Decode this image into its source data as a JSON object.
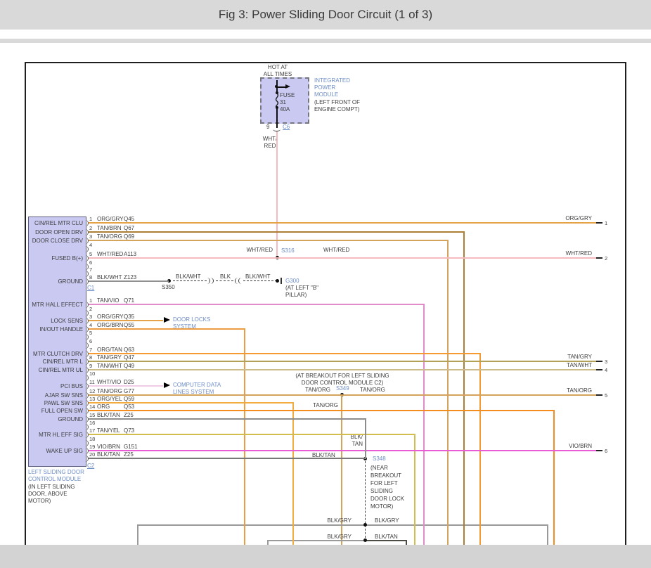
{
  "title": "Fig 3: Power Sliding Door Circuit (1 of 3)",
  "ipm": {
    "hot": "HOT AT\nALL TIMES",
    "fuse": "FUSE\n31\n40A",
    "name": "INTEGRATED\nPOWER\nMODULE",
    "location": "(LEFT FRONT OF\nENGINE COMPT)",
    "pin": "9",
    "connector": "C6",
    "wire": "WHT/\nRED"
  },
  "module": {
    "name": "LEFT SLIDING DOOR\nCONTROL MODULE",
    "location": "(IN LEFT SLIDING\nDOOR, ABOVE\nMOTOR)",
    "c1": "C1",
    "c2": "C2"
  },
  "c1_rows": [
    {
      "pin": "1",
      "label": "CIN/REL MTR CLU",
      "color": "ORG/GRY",
      "circuit": "Q45"
    },
    {
      "pin": "2",
      "label": "DOOR OPEN DRV",
      "color": "TAN/BRN",
      "circuit": "Q67"
    },
    {
      "pin": "3",
      "label": "DOOR CLOSE DRV",
      "color": "TAN/ORG",
      "circuit": "Q69"
    },
    {
      "pin": "4"
    },
    {
      "pin": "5",
      "label": "FUSED B(+)",
      "color": "WHT/RED",
      "circuit": "A113"
    },
    {
      "pin": "6"
    },
    {
      "pin": "7"
    },
    {
      "pin": "8",
      "label": "GROUND",
      "color": "BLK/WHT",
      "circuit": "Z123"
    }
  ],
  "c2_rows": [
    {
      "pin": "1",
      "label": "MTR HALL EFFECT",
      "color": "TAN/VIO",
      "circuit": "Q71"
    },
    {
      "pin": "2"
    },
    {
      "pin": "3",
      "label": "LOCK SENS",
      "color": "ORG/GRY",
      "circuit": "Q35"
    },
    {
      "pin": "4",
      "label": "IN/OUT HANDLE",
      "color": "ORG/BRN",
      "circuit": "Q55"
    },
    {
      "pin": "5"
    },
    {
      "pin": "6"
    },
    {
      "pin": "7",
      "label": "MTR CLUTCH DRV",
      "color": "ORG/TAN",
      "circuit": "Q63"
    },
    {
      "pin": "8",
      "label": "CIN/REL MTR L",
      "color": "TAN/GRY",
      "circuit": "Q47"
    },
    {
      "pin": "9",
      "label": "CIN/REL MTR UL",
      "color": "TAN/WHT",
      "circuit": "Q49"
    },
    {
      "pin": "10"
    },
    {
      "pin": "11",
      "label": "PCI BUS",
      "color": "WHT/VIO",
      "circuit": "D25"
    },
    {
      "pin": "12",
      "label": "AJAR SW SNS",
      "color": "TAN/ORG",
      "circuit": "G77"
    },
    {
      "pin": "13",
      "label": "PAWL SW SNS",
      "color": "ORG/YEL",
      "circuit": "Q59"
    },
    {
      "pin": "14",
      "label": "FULL OPEN SW",
      "color": "ORG",
      "circuit": "Q53"
    },
    {
      "pin": "15",
      "label": "GROUND",
      "color": "BLK/TAN",
      "circuit": "Z25"
    },
    {
      "pin": "16"
    },
    {
      "pin": "17",
      "label": "MTR HL EFF SIG",
      "color": "TAN/YEL",
      "circuit": "Q73"
    },
    {
      "pin": "18"
    },
    {
      "pin": "19",
      "label": "WAKE UP SIG",
      "color": "VIO/BRN",
      "circuit": "G151"
    },
    {
      "pin": "20",
      "color": "BLK/TAN",
      "circuit": "Z25"
    }
  ],
  "right_pins": [
    {
      "num": "1",
      "wire": "ORG/GRY"
    },
    {
      "num": "2",
      "wire": "WHT/RED"
    },
    {
      "num": "3",
      "wire": "TAN/GRY"
    },
    {
      "num": "4",
      "wire": "TAN/WHT"
    },
    {
      "num": "5",
      "wire": "TAN/ORG"
    },
    {
      "num": "6",
      "wire": "VIO/BRN"
    }
  ],
  "arrows": {
    "door_locks": "DOOR LOCKS\nSYSTEM",
    "computer_data": "COMPUTER DATA\nLINES SYSTEM"
  },
  "splices": {
    "s316": "S316",
    "s316_left": "WHT/RED",
    "s316_right": "WHT/RED",
    "s349": "S349",
    "s349_left": "TAN/ORG",
    "s349_right": "TAN/ORG",
    "s349_branch": "TAN/ORG",
    "s349_note": "(AT BREAKOUT FOR LEFT SLIDING\nDOOR CONTROL MODULE C2)",
    "s348": "S348",
    "s348_note": "(NEAR\nBREAKOUT\nFOR LEFT\nSLIDING\nDOOR LOCK\nMOTOR)",
    "s350": "S350",
    "g300": "G300",
    "g300_note": "(AT LEFT \"B\"\nPILLAR)"
  },
  "ground_path": {
    "seg1": "BLK/WHT",
    "seg2": "BLK",
    "seg3": "BLK/WHT"
  },
  "mid_labels": {
    "blk_tan_vertical": "BLK/\nTAN",
    "blk_tan_20": "BLK/TAN"
  },
  "bottom": {
    "r1_left": "BLK/GRY",
    "r1_right": "BLK/GRY",
    "r2_left": "BLK/GRY",
    "r2_right": "BLK/TAN"
  },
  "colors": {
    "module_fill": "#c9c9f1",
    "label_blue": "#6d8dc6",
    "org_gry": "#e7a247",
    "tan_brn": "#ab8036",
    "tan_org": "#d4a45f",
    "wht_red": "#f4babd",
    "blk_wht": "#909090",
    "tan_vio": "#df8cc9",
    "org_brn": "#ec9c43",
    "org_tan": "#f49a31",
    "tan_gry": "#b1a257",
    "tan_wht": "#ccbc8c",
    "wht_vio": "#f0cce6",
    "org_yel": "#f2ab3e",
    "org": "#f48d20",
    "blk_tan": "#8d8d8d",
    "tan_yel": "#d3bd4d",
    "vio_brn": "#e95bd4",
    "blk_gry": "#9a9a9a"
  }
}
